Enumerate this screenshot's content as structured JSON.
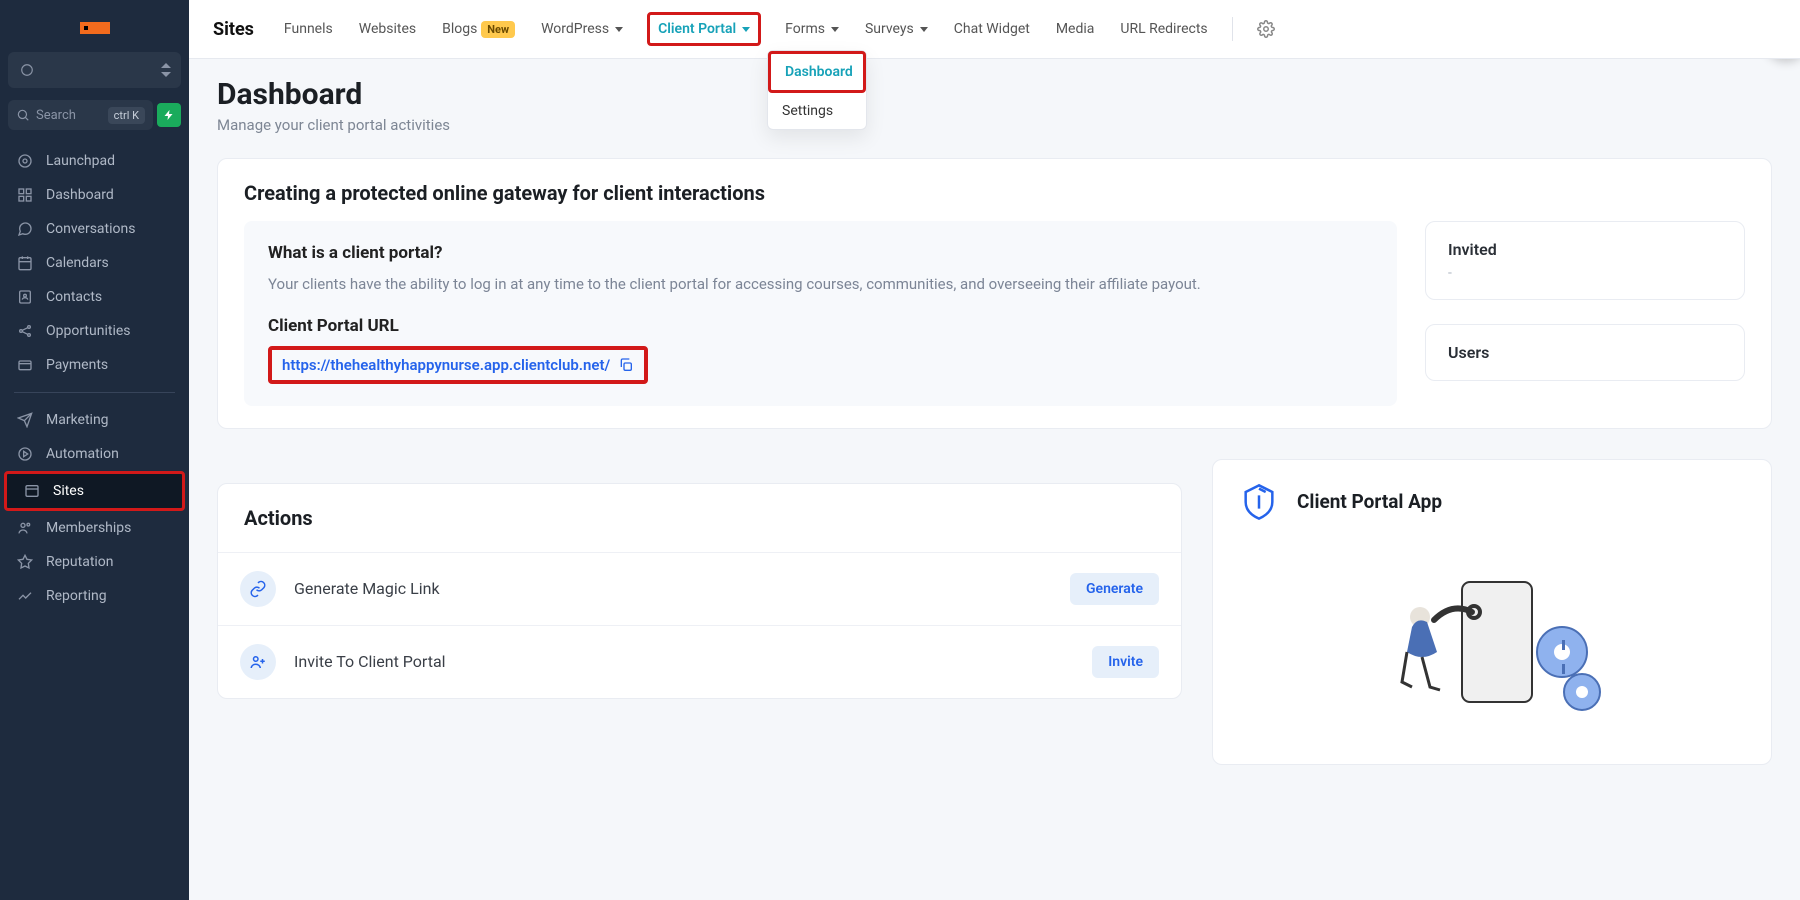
{
  "sidebar": {
    "search_placeholder": "Search",
    "shortcut": "ctrl K",
    "group1": [
      "Launchpad",
      "Dashboard",
      "Conversations",
      "Calendars",
      "Contacts",
      "Opportunities",
      "Payments"
    ],
    "group2": [
      "Marketing",
      "Automation",
      "Sites",
      "Memberships",
      "Reputation",
      "Reporting"
    ],
    "active": "Sites"
  },
  "topbar": {
    "title": "Sites",
    "tabs": {
      "funnels": "Funnels",
      "websites": "Websites",
      "blogs": "Blogs",
      "blogs_badge": "New",
      "wordpress": "WordPress",
      "client_portal": "Client Portal",
      "forms": "Forms",
      "surveys": "Surveys",
      "chat_widget": "Chat Widget",
      "media": "Media",
      "url_redirects": "URL Redirects"
    }
  },
  "dropdown": {
    "dashboard": "Dashboard",
    "settings": "Settings"
  },
  "page": {
    "title": "Dashboard",
    "subtitle": "Manage your client portal activities"
  },
  "gateway": {
    "heading": "Creating a protected online gateway for client interactions",
    "question": "What is a client portal?",
    "desc": "Your clients have the ability to log in at any time to the client portal for accessing courses, communities, and overseeing their affiliate payout.",
    "url_label": "Client Portal URL",
    "url": "https://thehealthyhappynurse.app.clientclub.net/"
  },
  "stats": {
    "invited": "Invited",
    "invited_val": "-",
    "users": "Users"
  },
  "actions": {
    "title": "Actions",
    "magic": "Generate Magic Link",
    "magic_btn": "Generate",
    "invite": "Invite To Client Portal",
    "invite_btn": "Invite"
  },
  "app": {
    "title": "Client Portal App"
  }
}
